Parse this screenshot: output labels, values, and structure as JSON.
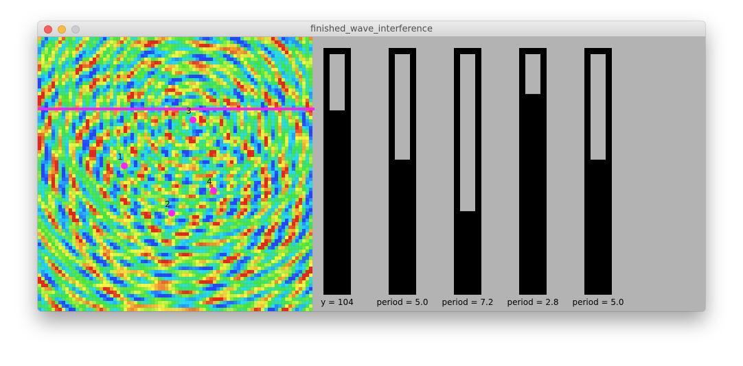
{
  "window": {
    "title": "finished_wave_interference"
  },
  "colors": {
    "marker": "#ff22ff",
    "bar_frame": "#000000",
    "bar_fill": "#b3b3b3",
    "background": "#b3b3b3"
  },
  "sources": [
    {
      "label": "1"
    },
    {
      "label": "2"
    },
    {
      "label": "3"
    },
    {
      "label": "4"
    }
  ],
  "scanline": {
    "y_label": "y = 104"
  },
  "bars": [
    {
      "label": "y = 104",
      "level": 0.76
    },
    {
      "label": "period = 5.0",
      "level": 0.55
    },
    {
      "label": "period = 7.2",
      "level": 0.33
    },
    {
      "label": "period = 2.8",
      "level": 0.83
    },
    {
      "label": "period = 5.0",
      "level": 0.55
    }
  ]
}
